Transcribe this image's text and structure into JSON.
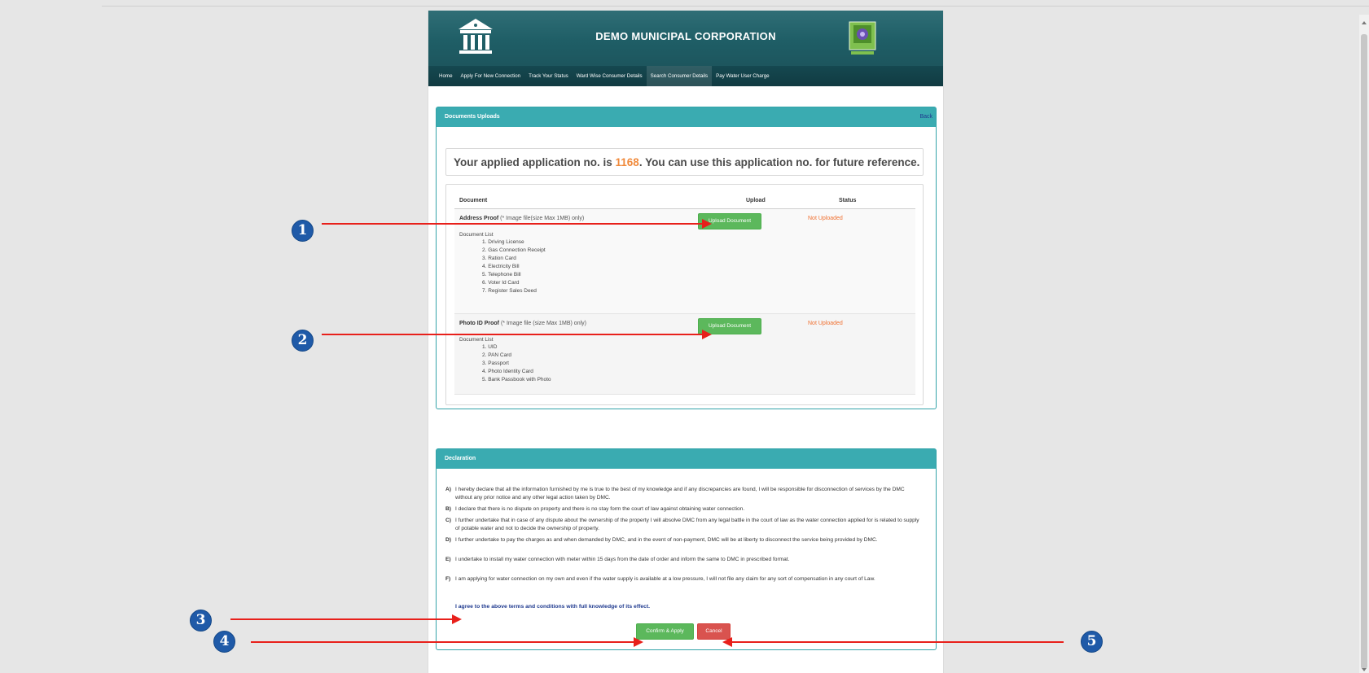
{
  "header": {
    "title": "DEMO MUNICIPAL CORPORATION",
    "left_logo_icon": "building-columns-icon",
    "right_logo_icon": "emblem-seal-icon"
  },
  "nav": {
    "items": [
      {
        "label": "Home"
      },
      {
        "label": "Apply For New Connection"
      },
      {
        "label": "Track Your Status"
      },
      {
        "label": "Ward Wise Consumer Details"
      },
      {
        "label": "Search Consumer Details"
      },
      {
        "label": "Pay Water User Charge"
      }
    ]
  },
  "documents_panel": {
    "title": "Documents Uploads",
    "back_label": "Back",
    "message_prefix": "Your applied application no. is ",
    "application_no": "1168",
    "message_suffix": ". You can use this application no. for future reference.",
    "columns": {
      "document": "Document",
      "upload": "Upload",
      "status": "Status"
    },
    "rows": [
      {
        "name": "Address Proof",
        "hint": " (* Image file(size Max 1MB) only)",
        "list_title": "Document List",
        "list": [
          "1.  Driving License",
          "2.  Gas Connection Receipt",
          "3.  Ration Card",
          "4.  Electricity Bill",
          "5.  Telephone Bill",
          "6.  Voter Id Card",
          "7.  Register Sales Deed"
        ],
        "upload_label": "Upload Document",
        "status": "Not Uploaded"
      },
      {
        "name": "Photo ID Proof",
        "hint": " (* Image file (size Max 1MB) only)",
        "list_title": "Document List",
        "list": [
          "1.  UID",
          "2.  PAN Card",
          "3.  Passport",
          "4.  Photo Identity Card",
          "5.  Bank Passbook with Photo"
        ],
        "upload_label": "Upload Document",
        "status": "Not Uploaded"
      }
    ]
  },
  "declaration_panel": {
    "title": "Declaration",
    "items": [
      {
        "letter": "A)",
        "text": "I hereby declare that all the information furnished by me is true to the best of my knowledge and if any discrepancies are found, I will be responsible for disconnection of services by the DMC without any prior notice and any other legal action taken by DMC."
      },
      {
        "letter": "B)",
        "text": "I declare that there is no dispute on property and there is no stay form the court of law against obtaining water connection."
      },
      {
        "letter": "C)",
        "text": "I further undertake that in case of any dispute about the ownership of the property I will absolve DMC from any legal battle in the court of law as the water connection applied for is related to supply of potable water and not to decide the ownership of property."
      },
      {
        "letter": "D)",
        "text": "I further undertake to pay the charges as and when demanded by DMC, and in the event of non-payment, DMC will be at liberty to disconnect the service being provided by DMC."
      },
      {
        "letter": "E)",
        "text": "I undertake to install my water connection with meter within 15 days from the date of order and inform the same to DMC in prescribed format."
      },
      {
        "letter": "F)",
        "text": "I am applying for water connection on my own and even if the water supply is available at a low pressure, I will not file any claim for any sort of compensation in any court of Law."
      }
    ],
    "agree_text": "I agree to the above terms and conditions with full knowledge of its effect.",
    "confirm_label": "Confirm & Apply",
    "cancel_label": "Cancel"
  },
  "annotations": {
    "color": "#e8201b",
    "badge_color": "#1f5aa8",
    "badges": [
      "1",
      "2",
      "3",
      "4",
      "5"
    ]
  }
}
